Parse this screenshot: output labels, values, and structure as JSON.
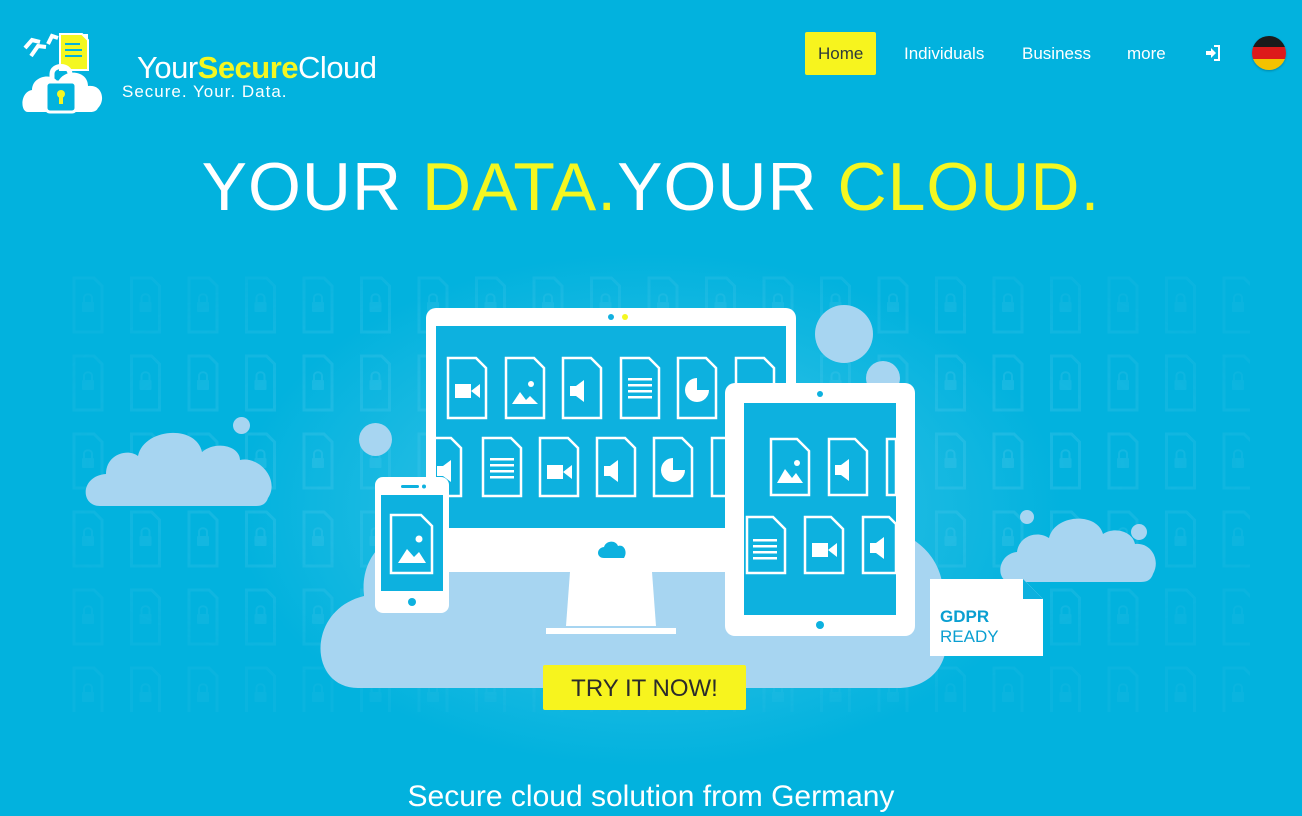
{
  "brand": {
    "name_part1": "Your",
    "name_part2": "Secure",
    "name_part3": "Cloud",
    "tagline": "Secure. Your. Data."
  },
  "nav": {
    "items": [
      {
        "label": "Home",
        "active": true
      },
      {
        "label": "Individuals",
        "active": false
      },
      {
        "label": "Business",
        "active": false
      },
      {
        "label": "more",
        "active": false
      }
    ],
    "login_icon": "sign-in-icon",
    "language_flag": "germany-flag-icon"
  },
  "hero": {
    "headline_part1": "YOUR ",
    "headline_part2": "DATA.",
    "headline_part3": "YOUR ",
    "headline_part4": "CLOUD.",
    "gdpr_line1": "GDPR",
    "gdpr_line2": "READY",
    "cta_label": "TRY IT NOW!"
  },
  "section": {
    "subtitle": "Secure cloud solution from Germany"
  },
  "colors": {
    "background": "#02b2de",
    "accent_yellow": "#f7f41e",
    "cloud_light": "#a7d5f1",
    "white": "#ffffff"
  }
}
